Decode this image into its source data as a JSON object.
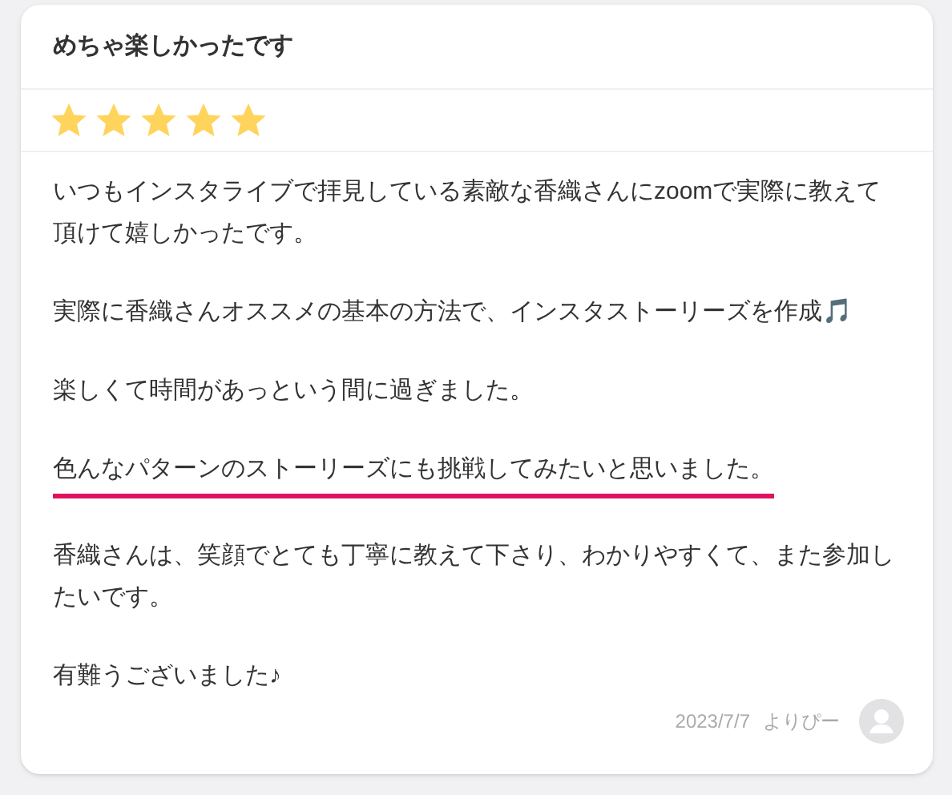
{
  "review": {
    "title": "めちゃ楽しかったです",
    "stars": 5,
    "paragraphs": [
      {
        "text": "いつもインスタライブで拝見している素敵な香織さんにzoomで実際に教えて頂けて嬉しかったです。",
        "underlined": false
      },
      {
        "text": "実際に香織さんオススメの基本の方法で、インスタストーリーズを作成🎵",
        "underlined": false
      },
      {
        "text": "楽しくて時間があっという間に過ぎました。",
        "underlined": false
      },
      {
        "text": "色んなパターンのストーリーズにも挑戦してみたいと思いました。",
        "underlined": true
      },
      {
        "text": "香織さんは、笑顔でとても丁寧に教えて下さり、わかりやすくて、また参加したいです。",
        "underlined": false
      },
      {
        "text": "有難うございました♪",
        "underlined": false
      }
    ],
    "date": "2023/7/7",
    "author": "よりぴー"
  }
}
